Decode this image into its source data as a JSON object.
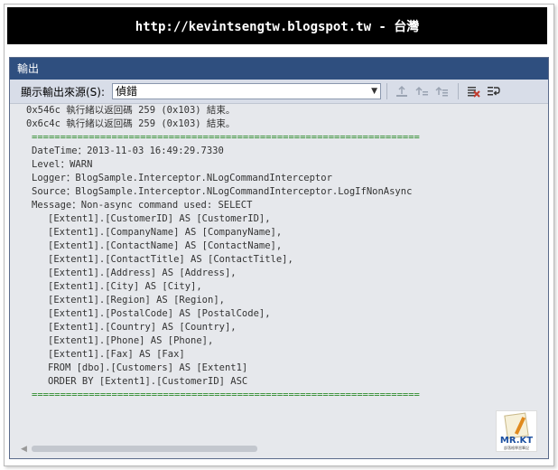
{
  "banner": {
    "text": "http://kevintsengtw.blogspot.tw - 台灣"
  },
  "panel": {
    "title": "輸出"
  },
  "toolbar": {
    "source_label": "顯示輸出來源(S):",
    "source_value": "偵錯"
  },
  "output_lines": [
    {
      "text": "0x546c 執行緒以返回碼 259 (0x103) 結束。",
      "style": "plain"
    },
    {
      "text": "0x6c4c 執行緒以返回碼 259 (0x103) 結束。",
      "style": "plain"
    },
    {
      "text": "====================================================================",
      "style": "sep"
    },
    {
      "text": "DateTime：2013-11-03 16:49:29.7330",
      "style": "indent1"
    },
    {
      "text": "Level：WARN",
      "style": "indent1"
    },
    {
      "text": "Logger：BlogSample.Interceptor.NLogCommandInterceptor",
      "style": "indent1"
    },
    {
      "text": "Source：BlogSample.Interceptor.NLogCommandInterceptor.LogIfNonAsync",
      "style": "indent1"
    },
    {
      "text": "Message：Non-async command used: SELECT",
      "style": "indent1"
    },
    {
      "text": "[Extent1].[CustomerID] AS [CustomerID],",
      "style": "indent2"
    },
    {
      "text": "[Extent1].[CompanyName] AS [CompanyName],",
      "style": "indent2"
    },
    {
      "text": "[Extent1].[ContactName] AS [ContactName],",
      "style": "indent2"
    },
    {
      "text": "[Extent1].[ContactTitle] AS [ContactTitle],",
      "style": "indent2"
    },
    {
      "text": "[Extent1].[Address] AS [Address],",
      "style": "indent2"
    },
    {
      "text": "[Extent1].[City] AS [City],",
      "style": "indent2"
    },
    {
      "text": "[Extent1].[Region] AS [Region],",
      "style": "indent2"
    },
    {
      "text": "[Extent1].[PostalCode] AS [PostalCode],",
      "style": "indent2"
    },
    {
      "text": "[Extent1].[Country] AS [Country],",
      "style": "indent2"
    },
    {
      "text": "[Extent1].[Phone] AS [Phone],",
      "style": "indent2"
    },
    {
      "text": "[Extent1].[Fax] AS [Fax]",
      "style": "indent2"
    },
    {
      "text": "FROM [dbo].[Customers] AS [Extent1]",
      "style": "indent2"
    },
    {
      "text": "ORDER BY [Extent1].[CustomerID] ASC",
      "style": "indent2"
    },
    {
      "text": "====================================================================",
      "style": "sep"
    }
  ],
  "logo": {
    "text": "MR.KT",
    "sub": "部落格學習筆記"
  },
  "icons": {
    "goto_prev": "goto-previous-message-icon",
    "goto_next": "goto-next-message-icon",
    "find_msg": "find-message-icon",
    "clear_all": "clear-all-icon",
    "word_wrap": "toggle-word-wrap-icon"
  },
  "colors": {
    "title_bar": "#2f4f7f",
    "separator": "#2a8a2a",
    "clear_icon": "#c0392b"
  }
}
